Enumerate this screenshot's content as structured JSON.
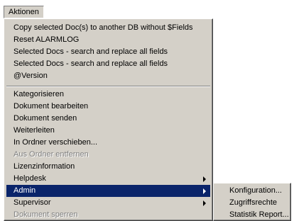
{
  "menubar": {
    "aktionen": "Aktionen"
  },
  "menu": {
    "items": [
      {
        "label": "Copy selected Doc(s) to another DB without $Fields"
      },
      {
        "label": "Reset ALARMLOG"
      },
      {
        "label": "Selected Docs - search and replace all fields"
      },
      {
        "label": "Selected Docs - search and replace all fields"
      },
      {
        "label": "@Version"
      },
      {
        "label": "Kategorisieren"
      },
      {
        "label": "Dokument bearbeiten"
      },
      {
        "label": "Dokument  senden"
      },
      {
        "label": "Weiterleiten"
      },
      {
        "label": "In Ordner verschieben..."
      },
      {
        "label": "Aus Ordner entfernen",
        "disabled": true
      },
      {
        "label": "Lizenzinformation"
      },
      {
        "label": "Helpdesk",
        "submenu": true
      },
      {
        "label": "Admin",
        "submenu": true,
        "highlighted": true
      },
      {
        "label": "Supervisor",
        "submenu": true
      },
      {
        "label": "Dokument sperren",
        "disabled": true
      }
    ]
  },
  "submenu": {
    "items": [
      {
        "label": "Konfiguration..."
      },
      {
        "label": "Zugriffsrechte"
      },
      {
        "label": "Statistik Report..."
      }
    ]
  },
  "colors": {
    "menu_bg": "#d4d0c8",
    "highlight": "#0a246a",
    "disabled": "#808080"
  }
}
